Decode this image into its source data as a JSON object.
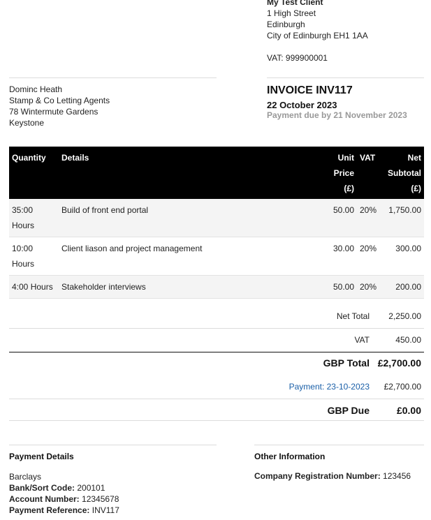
{
  "client": {
    "name": "My Test Client",
    "address": [
      "1 High Street",
      "Edinburgh",
      "City of Edinburgh EH1 1AA"
    ],
    "vat": "VAT: 999900001"
  },
  "bill_to": {
    "lines": [
      "Dominc Heath",
      "Stamp & Co Letting Agents",
      "78 Wintermute Gardens",
      "Keystone"
    ]
  },
  "invoice": {
    "title": "INVOICE INV117",
    "date": "22 October 2023",
    "due": "Payment due by 21 November 2023"
  },
  "table": {
    "headers": {
      "quantity": "Quantity",
      "details": "Details",
      "unit_price": [
        "Unit",
        "Price",
        "(£)"
      ],
      "vat": "VAT",
      "net_subtotal": [
        "Net",
        "Subtotal",
        "(£)"
      ]
    },
    "rows": [
      {
        "quantity": "35:00 Hours",
        "details": "Build of front end portal",
        "unit_price": "50.00",
        "vat": "20%",
        "subtotal": "1,750.00"
      },
      {
        "quantity": "10:00 Hours",
        "details": "Client liason and project management",
        "unit_price": "30.00",
        "vat": "20%",
        "subtotal": "300.00"
      },
      {
        "quantity": "4:00 Hours",
        "details": "Stakeholder interviews",
        "unit_price": "50.00",
        "vat": "20%",
        "subtotal": "200.00"
      }
    ]
  },
  "totals": {
    "net_total_label": "Net Total",
    "net_total": "2,250.00",
    "vat_label": "VAT",
    "vat": "450.00",
    "gbp_total_label": "GBP Total",
    "gbp_total": "£2,700.00",
    "payment_label": "Payment: 23-10-2023",
    "payment": "£2,700.00",
    "gbp_due_label": "GBP Due",
    "gbp_due": "£0.00"
  },
  "payment_details": {
    "title": "Payment Details",
    "bank": "Barclays",
    "sort_code_label": "Bank/Sort Code:",
    "sort_code": "200101",
    "account_label": "Account Number:",
    "account": "12345678",
    "reference_label": "Payment Reference:",
    "reference": "INV117"
  },
  "other_info": {
    "title": "Other Information",
    "reg_label": "Company Registration Number:",
    "reg": "123456"
  }
}
